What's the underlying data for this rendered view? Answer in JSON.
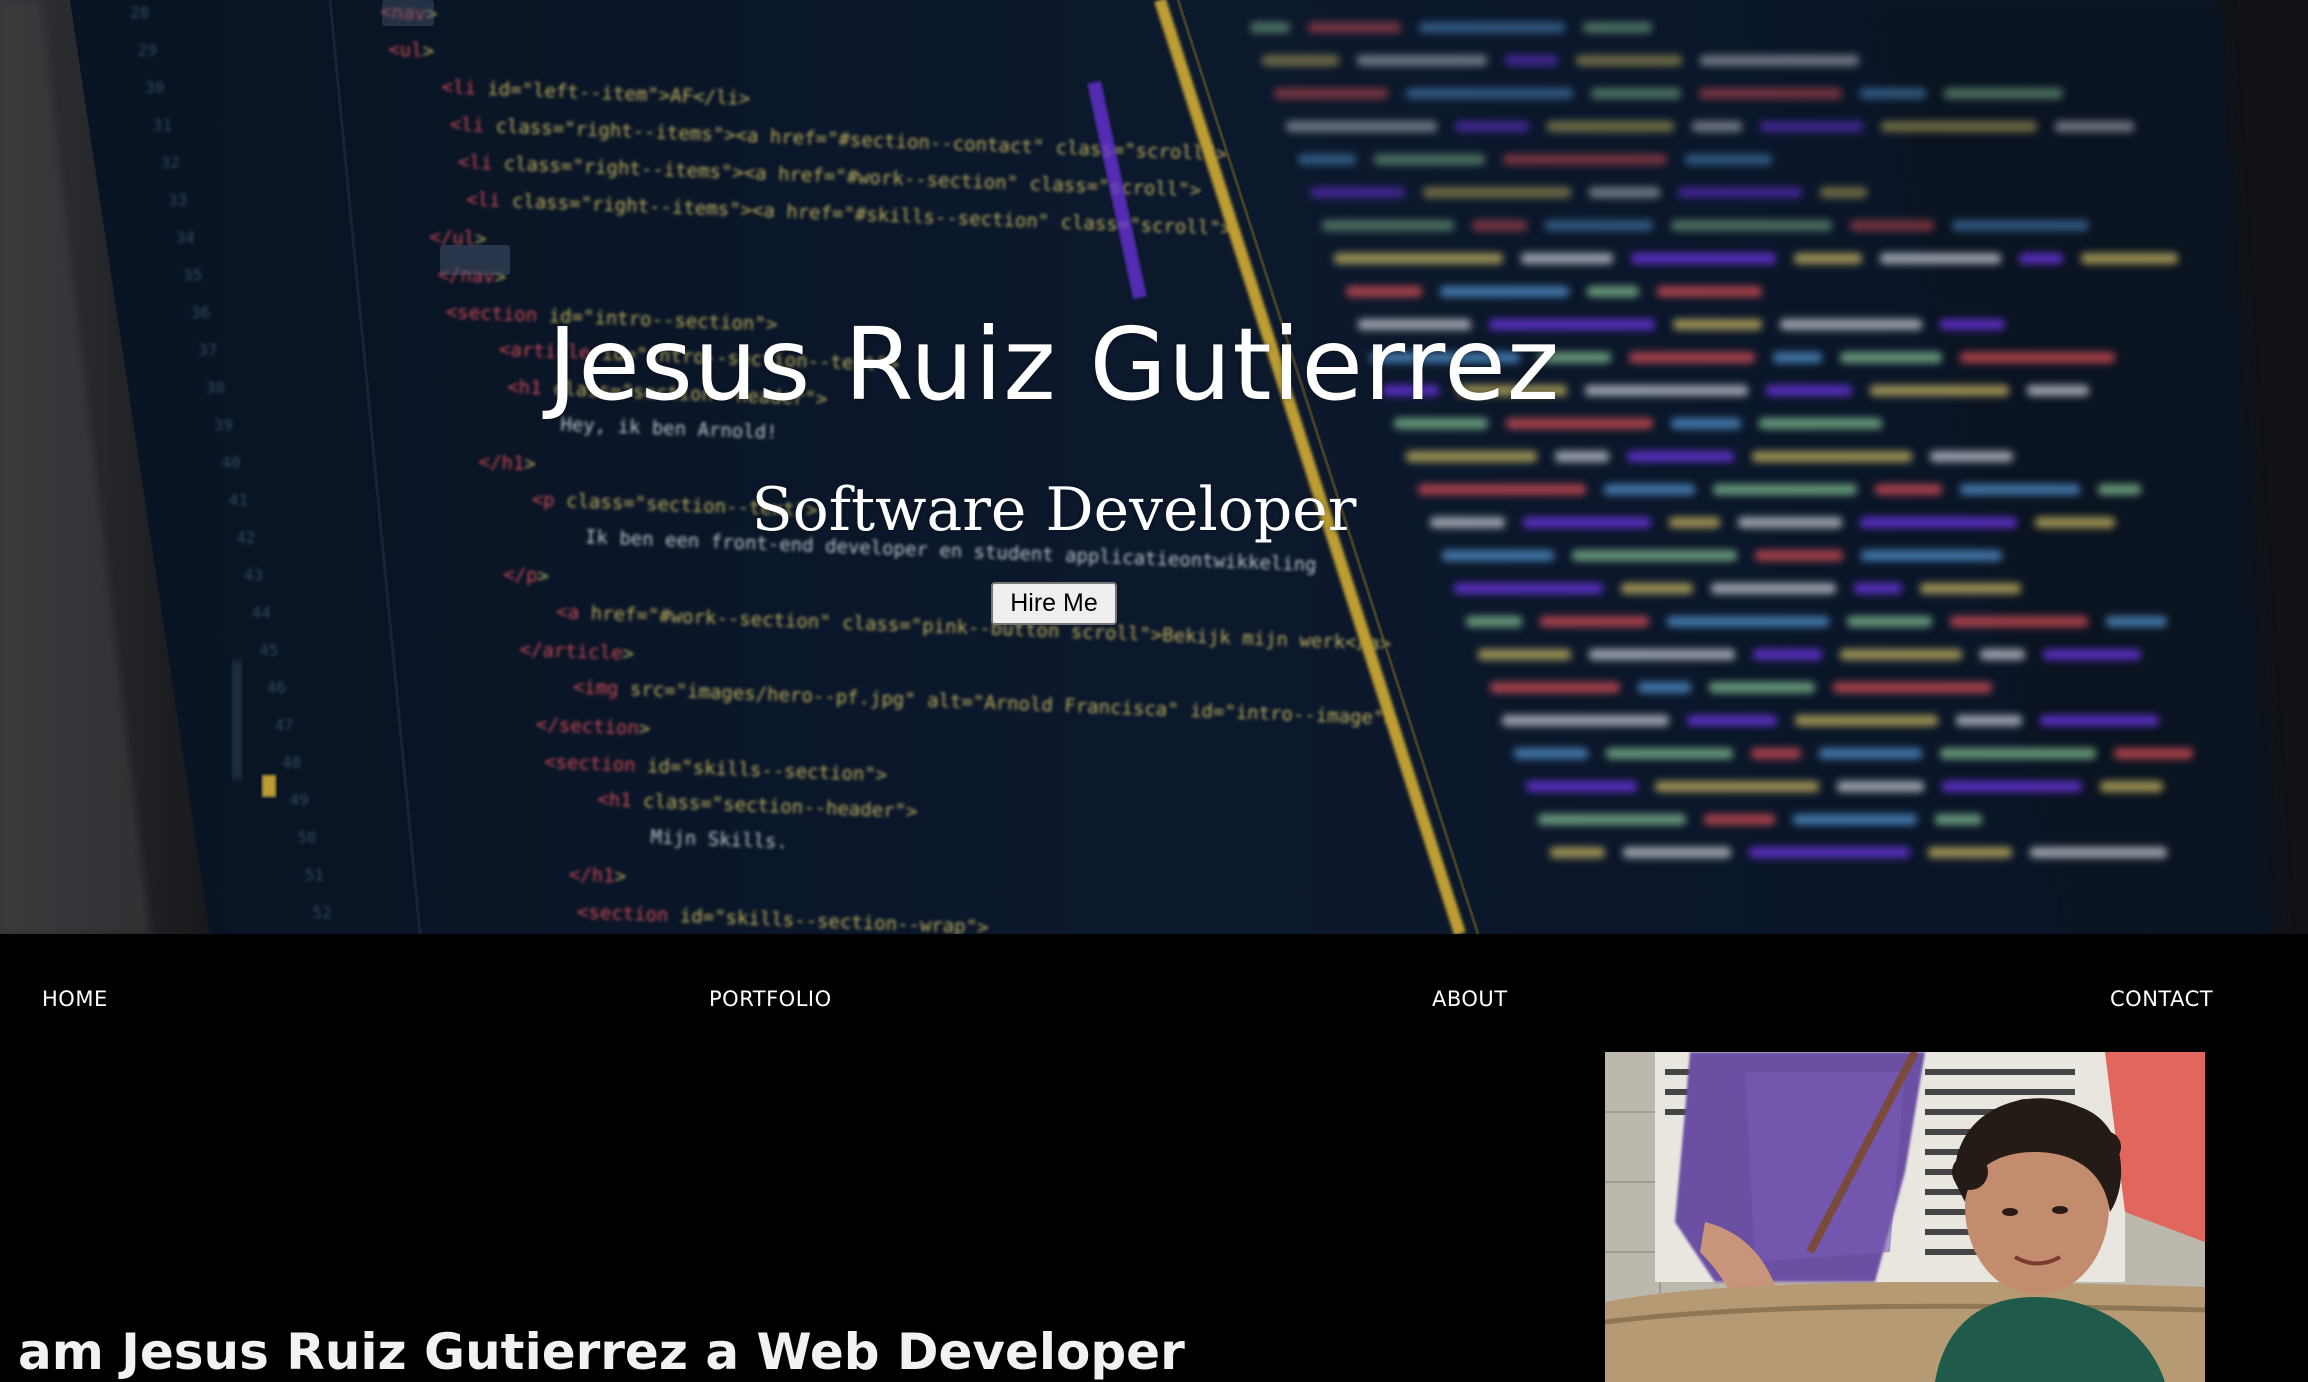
{
  "hero": {
    "title": "Jesus Ruiz Gutierrez",
    "subtitle": "Software Developer",
    "hire_button": "Hire Me",
    "background_image": "blurred-code-editor-photo",
    "code_lines": [
      "<nav>",
      "<ul>",
      "<li id=\"left--item\">AF</li>",
      "<li class=\"right--items\"><a href=\"#section--contact\" class=\"scroll\">",
      "<li class=\"right--items\"><a href=\"#work--section\" class=\"scroll\">",
      "<li class=\"right--items\"><a href=\"#skills--section\" class=\"scroll\">",
      "</ul>",
      "</nav>",
      "<section id=\"intro--section\">",
      "<article id=\"intro--section--text\">",
      "<h1 class=\"section--header\">",
      "Hey, ik ben Arnold!",
      "</h1>",
      "<p class=\"section--text\">",
      "Ik ben een front-end developer en student applicatieontwikkeling",
      "</p>",
      "<a href=\"#work--section\" class=\"pink--button scroll\">Bekijk mijn werk</a>",
      "</article>",
      "<img src=\"images/hero--pf.jpg\" alt=\"Arnold Francisca\" id=\"intro--image\">",
      "</section>",
      "<section id=\"skills--section\">",
      "<h1 class=\"section--header\">",
      "Mijn Skills.",
      "</h1>",
      "<section id=\"skills--section--wrap\">"
    ]
  },
  "nav": {
    "items": [
      "HOME",
      "PORTFOLIO",
      "ABOUT",
      "CONTACT"
    ]
  },
  "about": {
    "heading": "am Jesus Ruiz Gutierrez a Web Developer",
    "photo": "profile-photo"
  },
  "colors": {
    "page_background": "#000000",
    "text": "#ffffff",
    "editor_background": "#0d1a2e",
    "code_tag": "#e8555f",
    "code_attr": "#d8c76a",
    "code_string": "#8fd0a0",
    "code_text": "#d8dde6",
    "gutter_number": "#3d5270",
    "accent_yellow": "#d9b43a",
    "accent_purple": "#7a3bff"
  }
}
